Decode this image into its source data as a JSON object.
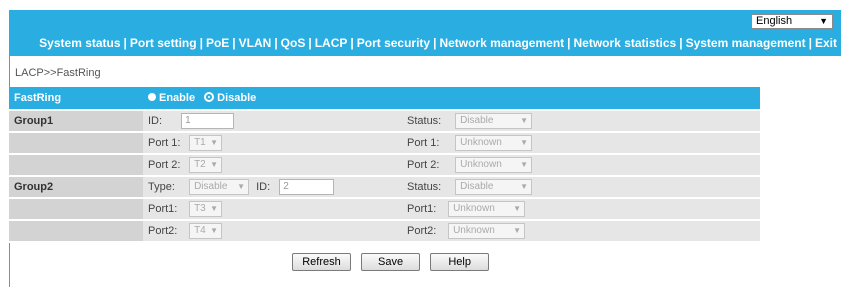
{
  "language": {
    "selected": "English"
  },
  "nav": [
    "System status",
    "Port setting",
    "PoE",
    "VLAN",
    "QoS",
    "LACP",
    "Port security",
    "Network management",
    "Network statistics",
    "System management",
    "Exit"
  ],
  "breadcrumb": "LACP>>FastRing",
  "fastring": {
    "label": "FastRing",
    "enable": "Enable",
    "disable": "Disable",
    "selected": "Disable"
  },
  "group1": {
    "name": "Group1",
    "id_label": "ID:",
    "id_value": "1",
    "status_label": "Status:",
    "status_value": "Disable",
    "port1_label": "Port 1:",
    "port1_value": "T1",
    "port1_status_label": "Port 1:",
    "port1_status_value": "Unknown",
    "port2_label": "Port 2:",
    "port2_value": "T2",
    "port2_status_label": "Port 2:",
    "port2_status_value": "Unknown"
  },
  "group2": {
    "name": "Group2",
    "type_label": "Type:",
    "type_value": "Disable",
    "id_label": "ID:",
    "id_value": "2",
    "status_label": "Status:",
    "status_value": "Disable",
    "port1_label": "Port1:",
    "port1_value": "T3",
    "port1_status_label": "Port1:",
    "port1_status_value": "Unknown",
    "port2_label": "Port2:",
    "port2_value": "T4",
    "port2_status_label": "Port2:",
    "port2_status_value": "Unknown"
  },
  "buttons": {
    "refresh": "Refresh",
    "save": "Save",
    "help": "Help"
  },
  "colors": {
    "accent": "#2aaee2",
    "label_bg": "#d3d3d3",
    "row_bg": "#e6e6e6"
  }
}
